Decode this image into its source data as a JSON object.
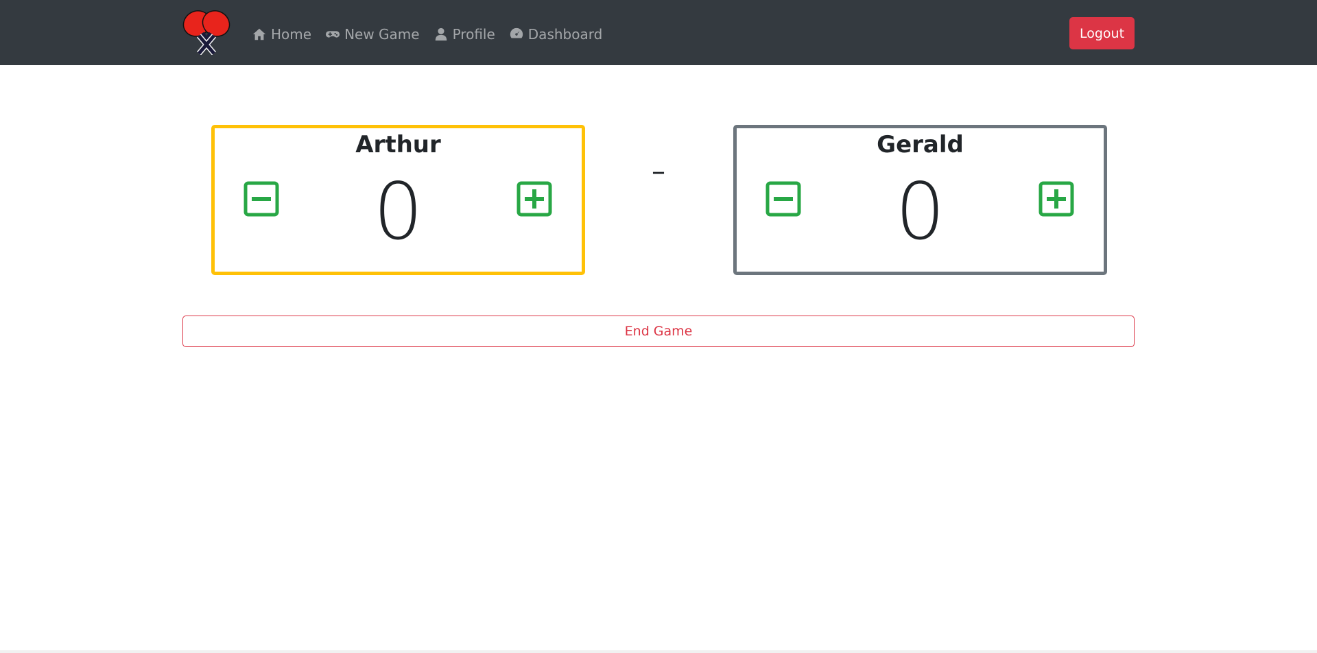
{
  "nav": {
    "brand_icon": "ping-pong-paddles-logo",
    "links": [
      {
        "label": "Home",
        "icon": "home-icon"
      },
      {
        "label": "New Game",
        "icon": "gamepad-icon"
      },
      {
        "label": "Profile",
        "icon": "user-icon"
      },
      {
        "label": "Dashboard",
        "icon": "tachometer-icon"
      }
    ],
    "logout_label": "Logout"
  },
  "match": {
    "player1": {
      "name": "Arthur",
      "score": "0",
      "border_color": "#ffc107"
    },
    "player2": {
      "name": "Gerald",
      "score": "0",
      "border_color": "#6c757d"
    },
    "separator": "–"
  },
  "actions": {
    "end_game_label": "End Game"
  },
  "colors": {
    "navbar": "#343a40",
    "danger": "#dc3545",
    "success": "#28a745",
    "active_player": "#ffc107",
    "inactive_player": "#6c757d"
  }
}
